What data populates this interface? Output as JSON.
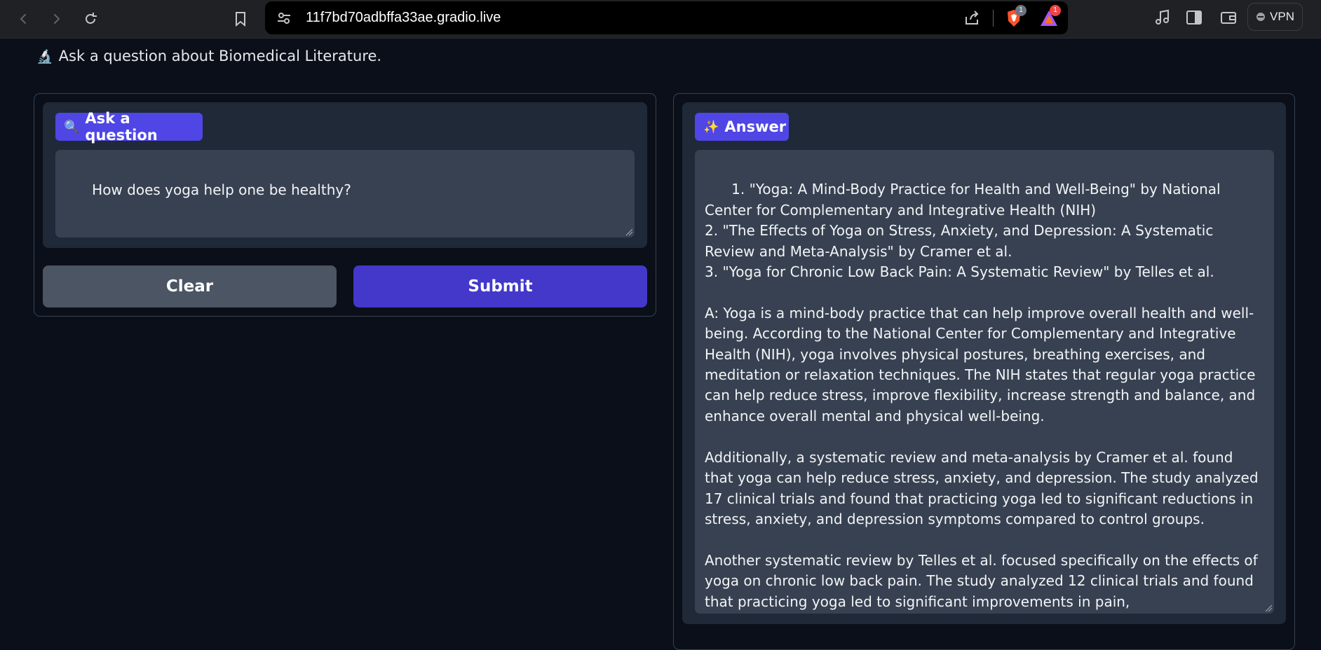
{
  "browser": {
    "url": "11f7bd70adbffa33ae.gradio.live",
    "brave_badge": "1",
    "rewards_badge": "1",
    "vpn_label": "VPN",
    "icons": {
      "back": "chevron-left-icon",
      "forward": "chevron-right-icon",
      "reload": "reload-icon",
      "bookmark": "bookmark-icon",
      "site_settings": "tune-icon",
      "share": "share-icon",
      "media": "music-note-icon",
      "sidebar": "sidebar-icon",
      "wallet": "wallet-icon"
    }
  },
  "page": {
    "subtitle": "Ask a question about Biomedical Literature.",
    "subtitle_icon": "🔬"
  },
  "question": {
    "label": "Ask a question",
    "label_icon": "🔍",
    "value": "How does yoga help one be healthy?"
  },
  "buttons": {
    "clear": "Clear",
    "submit": "Submit"
  },
  "answer": {
    "label": "Answer",
    "label_icon": "✨",
    "value": "1. \"Yoga: A Mind-Body Practice for Health and Well-Being\" by National Center for Complementary and Integrative Health (NIH)\n2. \"The Effects of Yoga on Stress, Anxiety, and Depression: A Systematic Review and Meta-Analysis\" by Cramer et al.\n3. \"Yoga for Chronic Low Back Pain: A Systematic Review\" by Telles et al.\n\nA: Yoga is a mind-body practice that can help improve overall health and well-being. According to the National Center for Complementary and Integrative Health (NIH), yoga involves physical postures, breathing exercises, and meditation or relaxation techniques. The NIH states that regular yoga practice can help reduce stress, improve flexibility, increase strength and balance, and enhance overall mental and physical well-being.\n\nAdditionally, a systematic review and meta-analysis by Cramer et al. found that yoga can help reduce stress, anxiety, and depression. The study analyzed 17 clinical trials and found that practicing yoga led to significant reductions in stress, anxiety, and depression symptoms compared to control groups.\n\nAnother systematic review by Telles et al. focused specifically on the effects of yoga on chronic low back pain. The study analyzed 12 clinical trials and found that practicing yoga led to significant improvements in pain,"
  },
  "colors": {
    "accent": "#4f46e5",
    "submit": "#4338ca",
    "clear": "#4b5563",
    "background": "#0b0f19",
    "block": "#1f2937",
    "input": "#374151"
  }
}
